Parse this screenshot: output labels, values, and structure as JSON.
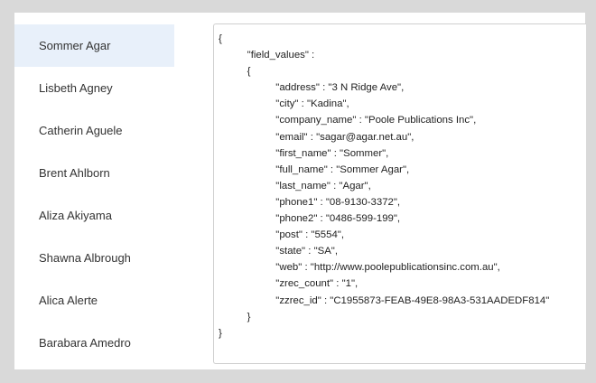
{
  "sidebar": {
    "items": [
      {
        "label": "Sommer Agar"
      },
      {
        "label": "Lisbeth Agney"
      },
      {
        "label": "Catherin Aguele"
      },
      {
        "label": "Brent Ahlborn"
      },
      {
        "label": "Aliza Akiyama"
      },
      {
        "label": "Shawna Albrough"
      },
      {
        "label": "Alica Alerte"
      },
      {
        "label": "Barabara Amedro"
      }
    ]
  },
  "record": {
    "lines": [
      "{",
      "          \"field_values\" :",
      "          {",
      "                    \"address\" : \"3 N Ridge Ave\",",
      "                    \"city\" : \"Kadina\",",
      "                    \"company_name\" : \"Poole Publications Inc\",",
      "                    \"email\" : \"sagar@agar.net.au\",",
      "                    \"first_name\" : \"Sommer\",",
      "                    \"full_name\" : \"Sommer Agar\",",
      "                    \"last_name\" : \"Agar\",",
      "                    \"phone1\" : \"08-9130-3372\",",
      "                    \"phone2\" : \"0486-599-199\",",
      "                    \"post\" : \"5554\",",
      "                    \"state\" : \"SA\",",
      "                    \"web\" : \"http://www.poolepublicationsinc.com.au\",",
      "                    \"zrec_count\" : \"1\",",
      "                    \"zzrec_id\" : \"C1955873-FEAB-49E8-98A3-531AADEDF814\"",
      "          }",
      "}"
    ]
  }
}
